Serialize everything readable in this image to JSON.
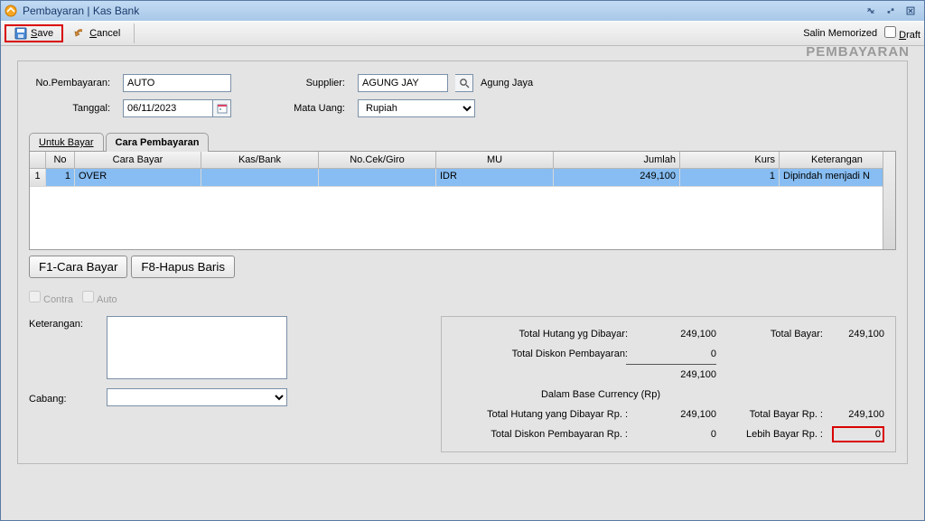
{
  "window": {
    "title": "Pembayaran | Kas Bank"
  },
  "toolbar": {
    "save_letter": "S",
    "save_rest": "ave",
    "cancel_letter": "C",
    "cancel_rest": "ancel",
    "salin_memorized": "Salin Memorized",
    "draft_letter": "D",
    "draft_rest": "raft"
  },
  "headline": "PEMBAYARAN",
  "form": {
    "no_pembayaran_label": "No.Pembayaran:",
    "no_pembayaran_value": "AUTO",
    "tanggal_label": "Tanggal:",
    "tanggal_value": "06/11/2023",
    "supplier_label": "Supplier:",
    "supplier_value": "AGUNG JAY",
    "supplier_name": "Agung Jaya",
    "mata_uang_label": "Mata Uang:",
    "mata_uang_value": "Rupiah"
  },
  "tabs": {
    "untuk_bayar": "Untuk Bayar",
    "cara_pembayaran": "Cara Pembayaran"
  },
  "grid": {
    "headers": {
      "no": "No",
      "cara_bayar": "Cara Bayar",
      "kas_bank": "Kas/Bank",
      "no_cek": "No.Cek/Giro",
      "mu": "MU",
      "jumlah": "Jumlah",
      "kurs": "Kurs",
      "keterangan": "Keterangan"
    },
    "rows": [
      {
        "rownum": "1",
        "no": "1",
        "cara_bayar": "OVER",
        "kas_bank": "",
        "no_cek": "",
        "mu": "IDR",
        "jumlah": "249,100",
        "kurs": "1",
        "keterangan": "Dipindah menjadi N"
      }
    ]
  },
  "fbtns": {
    "f1": "F1-Cara Bayar",
    "f8": "F8-Hapus Baris"
  },
  "checks": {
    "contra": "Contra",
    "auto": "Auto"
  },
  "left": {
    "keterangan_label": "Keterangan:",
    "cabang_label": "Cabang:",
    "cabang_value": ""
  },
  "totals": {
    "hutang_dibayar_label": "Total Hutang yg Dibayar:",
    "hutang_dibayar_value": "249,100",
    "total_bayar_label": "Total Bayar:",
    "total_bayar_value": "249,100",
    "diskon_label": "Total Diskon Pembayaran:",
    "diskon_value": "0",
    "subtotal": "249,100",
    "base_currency": "Dalam Base Currency (Rp)",
    "hutang_rp_label": "Total Hutang yang Dibayar Rp. :",
    "hutang_rp_value": "249,100",
    "total_bayar_rp_label": "Total Bayar Rp. :",
    "total_bayar_rp_value": "249,100",
    "diskon_rp_label": "Total Diskon Pembayaran Rp. :",
    "diskon_rp_value": "0",
    "lebih_bayar_label": "Lebih Bayar Rp. :",
    "lebih_bayar_value": "0"
  }
}
